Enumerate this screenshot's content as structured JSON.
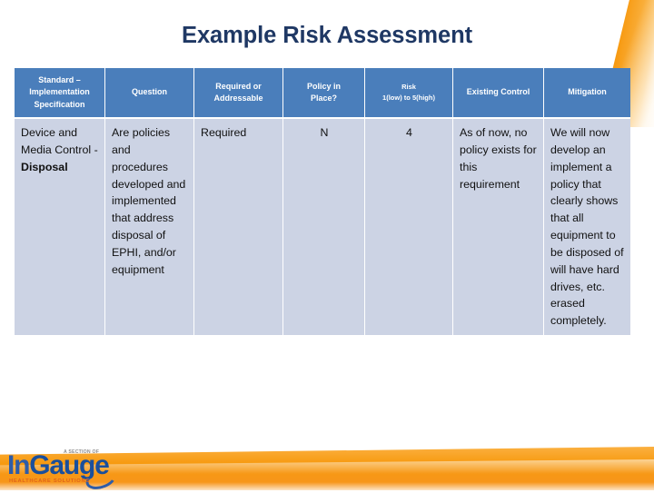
{
  "slide": {
    "title": "Example Risk Assessment",
    "title_color": "#1f3864"
  },
  "theme": {
    "header_blue": "#4a7ebb",
    "cell_blue": "#ccd3e4",
    "accent_orange": "#f7941e"
  },
  "table": {
    "headers": [
      {
        "line1": "Standard –",
        "line2": "Implementation",
        "line3": "Specification"
      },
      {
        "line1": "Question"
      },
      {
        "line1": "Required or",
        "line2": "Addressable"
      },
      {
        "line1": "Policy in",
        "line2": "Place?"
      },
      {
        "line1": "Risk",
        "sub": "1(low) to 5(high)"
      },
      {
        "line1": "Existing Control"
      },
      {
        "line1": "Mitigation"
      }
    ],
    "rows": [
      {
        "standard_plain": "Device and Media Control - ",
        "standard_bold": "Disposal",
        "question": "Are policies and procedures developed and implemented that address disposal of EPHI, and/or equipment",
        "required_or_addressable": "Required",
        "policy_in_place": "N",
        "risk": "4",
        "existing_control": "As of now, no policy exists for this requirement",
        "mitigation": "We will now develop an implement a policy that clearly shows that all equipment to be disposed of will have hard drives, etc. erased completely."
      }
    ]
  },
  "logo": {
    "part1": "In",
    "part2": "Gauge",
    "superscript": "A SECTION OF",
    "tagline": "HEALTHCARE SOLUTIONS"
  }
}
